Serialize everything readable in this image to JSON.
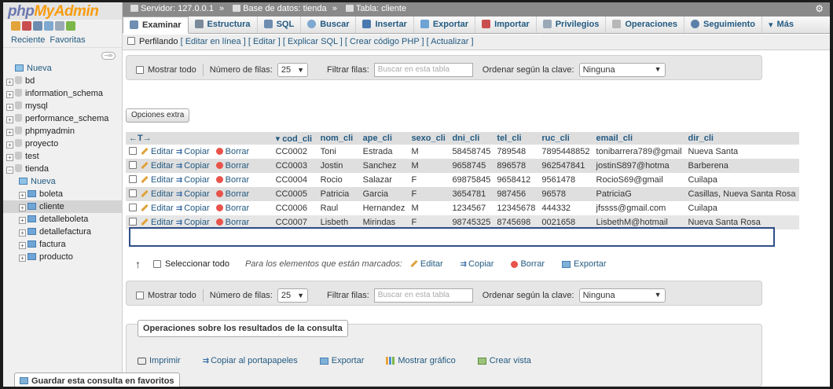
{
  "logo": {
    "part1": "php",
    "part2": "MyAdmin"
  },
  "nav": {
    "tabs": [
      "Reciente",
      "Favoritas"
    ],
    "tree": [
      {
        "label": "Nueva",
        "kind": "new",
        "level": 1
      },
      {
        "label": "bd",
        "kind": "db",
        "level": 1
      },
      {
        "label": "information_schema",
        "kind": "db",
        "level": 1
      },
      {
        "label": "mysql",
        "kind": "db",
        "level": 1
      },
      {
        "label": "performance_schema",
        "kind": "db",
        "level": 1
      },
      {
        "label": "phpmyadmin",
        "kind": "db",
        "level": 1
      },
      {
        "label": "proyecto",
        "kind": "db",
        "level": 1
      },
      {
        "label": "test",
        "kind": "db",
        "level": 1
      },
      {
        "label": "tienda",
        "kind": "db",
        "level": 1,
        "open": true
      },
      {
        "label": "Nueva",
        "kind": "new",
        "level": 2
      },
      {
        "label": "boleta",
        "kind": "table",
        "level": 2
      },
      {
        "label": "cliente",
        "kind": "table",
        "level": 2,
        "selected": true
      },
      {
        "label": "detalleboleta",
        "kind": "table",
        "level": 2
      },
      {
        "label": "detallefactura",
        "kind": "table",
        "level": 2
      },
      {
        "label": "factura",
        "kind": "table",
        "level": 2
      },
      {
        "label": "producto",
        "kind": "table",
        "level": 2
      }
    ]
  },
  "breadcrumb": {
    "server": "Servidor: 127.0.0.1",
    "database": "Base de datos: tienda",
    "table": "Tabla: cliente",
    "sep": "»"
  },
  "menu": [
    {
      "label": "Examinar",
      "icon": "browse-icon",
      "active": true,
      "color": "#6f8fb3"
    },
    {
      "label": "Estructura",
      "icon": "structure-icon",
      "color": "#7a8a9a"
    },
    {
      "label": "SQL",
      "icon": "sql-icon",
      "color": "#6d8db0"
    },
    {
      "label": "Buscar",
      "icon": "search-icon",
      "color": "#7fa9cf"
    },
    {
      "label": "Insertar",
      "icon": "insert-icon",
      "color": "#4a79b0"
    },
    {
      "label": "Exportar",
      "icon": "export-icon",
      "color": "#6ea3d3"
    },
    {
      "label": "Importar",
      "icon": "import-icon",
      "color": "#c94f4f"
    },
    {
      "label": "Privilegios",
      "icon": "privileges-icon",
      "color": "#9aa9b8"
    },
    {
      "label": "Operaciones",
      "icon": "wrench-icon",
      "color": "#b7b7b7"
    },
    {
      "label": "Seguimiento",
      "icon": "eye-icon",
      "color": "#5b7fa8"
    },
    {
      "label": "Más",
      "icon": "chevron-down-icon",
      "color": "#333333"
    }
  ],
  "profiling": {
    "label": "Perfilando",
    "links": "[ Editar en línea ] [ Editar ] [ Explicar SQL ] [ Crear código PHP ] [ Actualizar ]"
  },
  "nav_panel": {
    "show_all": "Mostrar todo",
    "rows_label": "Número de filas:",
    "rows_value": "25",
    "filter_label": "Filtrar filas:",
    "filter_placeholder": "Buscar en esta tabla",
    "sort_label": "Ordenar según la clave:",
    "sort_value": "Ninguna"
  },
  "extra_options": "Opciones extra",
  "columns": [
    "cod_cli",
    "nom_cli",
    "ape_cli",
    "sexo_cli",
    "dni_cli",
    "tel_cli",
    "ruc_cli",
    "email_cli",
    "dir_cli"
  ],
  "row_actions": {
    "edit": "Editar",
    "copy": "Copiar",
    "delete": "Borrar"
  },
  "rows": [
    [
      "CC0002",
      "Toni",
      "Estrada",
      "M",
      "58458745",
      "789548",
      "7895448852",
      "tonibarrera789@gmail",
      "Nueva Santa"
    ],
    [
      "CC0003",
      "Jostin",
      "Sanchez",
      "M",
      "9658745",
      "896578",
      "962547841",
      "jostinS897@hotma",
      "Barberena"
    ],
    [
      "CC0004",
      "Rocio",
      "Salazar",
      "F",
      "69875845",
      "9658412",
      "9561478",
      "RocioS69@gmail",
      "Cuilapa"
    ],
    [
      "CC0005",
      "Patricia",
      "Garcia",
      "F",
      "3654781",
      "987456",
      "96578",
      "PatriciaG",
      "Casillas, Nueva Santa Rosa"
    ],
    [
      "CC0006",
      "Raul",
      "Hernandez",
      "M",
      "1234567",
      "12345678",
      "444332",
      "jfssss@gmail.com",
      "Cuilapa"
    ],
    [
      "CC0007",
      "Lisbeth",
      "Mirindas",
      "F",
      "98745325",
      "8745698",
      "0021658",
      "LisbethM@hotmail",
      "Nueva Santa Rosa"
    ]
  ],
  "bulk": {
    "select_all": "Seleccionar todo",
    "with_selected": "Para los elementos que están marcados:",
    "edit": "Editar",
    "copy": "Copiar",
    "delete": "Borrar",
    "export": "Exportar"
  },
  "query_ops": {
    "legend": "Operaciones sobre los resultados de la consulta",
    "print": "Imprimir",
    "copy_clipboard": "Copiar al portapapeles",
    "export": "Exportar",
    "chart": "Mostrar gráfico",
    "create_view": "Crear vista"
  },
  "bookmark": "Guardar esta consulta en favoritos"
}
